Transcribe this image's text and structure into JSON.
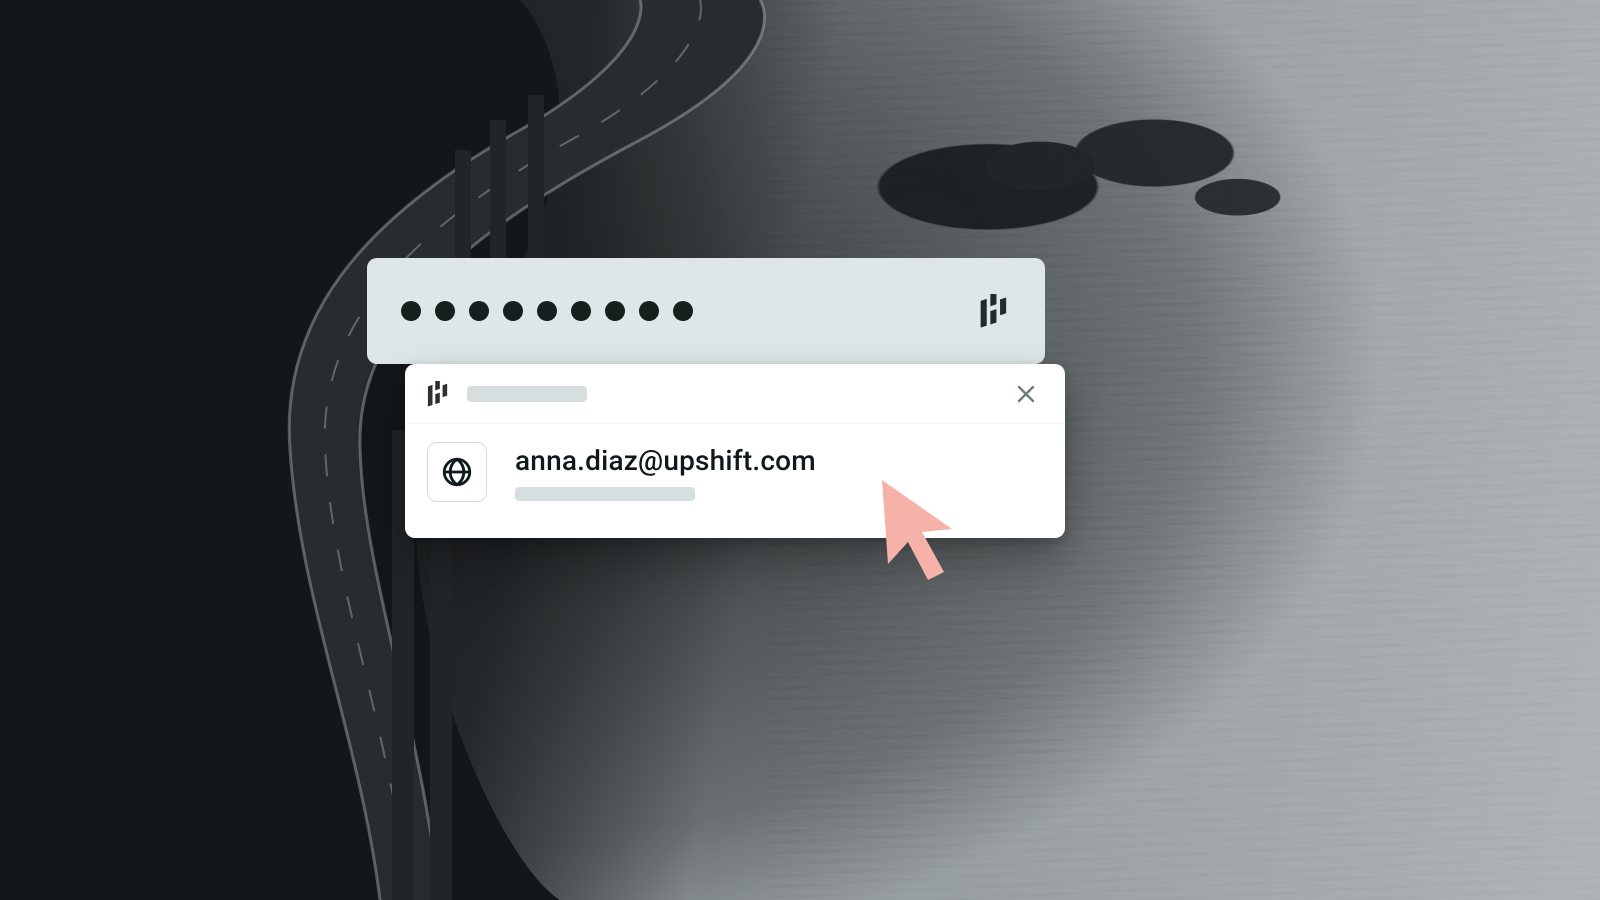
{
  "password_field": {
    "masked_length": 9,
    "action_icon": "dashlane-icon"
  },
  "autofill": {
    "brand_icon": "dashlane-icon",
    "close_icon": "close-icon",
    "suggestion": {
      "site_icon": "globe-icon",
      "username": "anna.diaz@upshift.com"
    }
  },
  "cursor": {
    "color": "#f6b1a9"
  }
}
